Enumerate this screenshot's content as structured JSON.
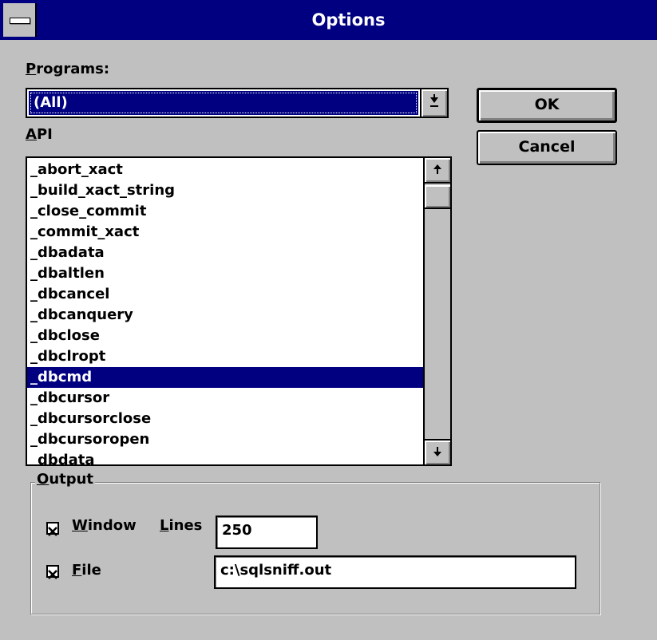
{
  "window": {
    "title": "Options"
  },
  "programs": {
    "label_key": "P",
    "label_rest": "rograms:",
    "selected": "(All)"
  },
  "api": {
    "label_key": "A",
    "label_rest": "PI",
    "items": [
      "_abort_xact",
      "_build_xact_string",
      "_close_commit",
      "_commit_xact",
      "_dbadata",
      "_dbaltlen",
      "_dbcancel",
      "_dbcanquery",
      "_dbclose",
      "_dbclropt",
      "_dbcmd",
      "_dbcursor",
      "_dbcursorclose",
      "_dbcursoropen",
      "_dbdata"
    ],
    "selected_index": 10
  },
  "buttons": {
    "ok": "OK",
    "cancel": "Cancel"
  },
  "output": {
    "label_key": "O",
    "label_rest": "utput",
    "window": {
      "key": "W",
      "rest": "indow",
      "checked": true
    },
    "lines": {
      "key": "L",
      "rest": "ines",
      "value": "250"
    },
    "file": {
      "key": "F",
      "rest": "ile",
      "checked": true,
      "value": "c:\\sqlsniff.out"
    }
  },
  "icons": {
    "system_menu": "system-menu-icon",
    "dropdown": "dropdown-arrow-icon",
    "scroll_up": "arrow-up-icon",
    "scroll_down": "arrow-down-icon",
    "check": "checkmark-x-icon"
  },
  "colors": {
    "title_bar": "#000080",
    "face": "#c0c0c0",
    "selection": "#000080"
  }
}
